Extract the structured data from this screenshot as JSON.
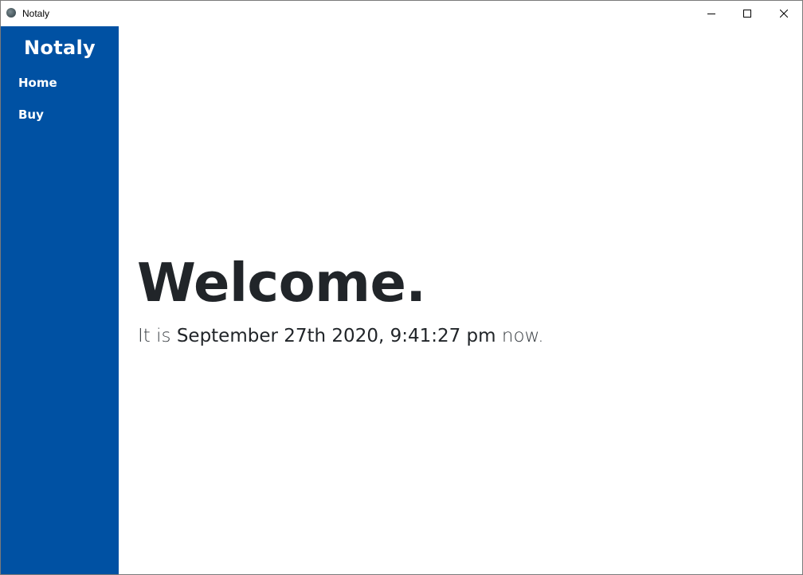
{
  "window": {
    "title": "Notaly",
    "controls": {
      "minimize_icon": "minimize-icon",
      "maximize_icon": "maximize-icon",
      "close_icon": "close-icon"
    }
  },
  "sidebar": {
    "brand": "Notaly",
    "background_color": "#0051a3",
    "items": [
      {
        "label": "Home"
      },
      {
        "label": "Buy"
      }
    ]
  },
  "main": {
    "heading": "Welcome.",
    "now_prefix": "It is",
    "now_datetime": "September 27th 2020, 9:41:27 pm",
    "now_suffix": "now."
  }
}
